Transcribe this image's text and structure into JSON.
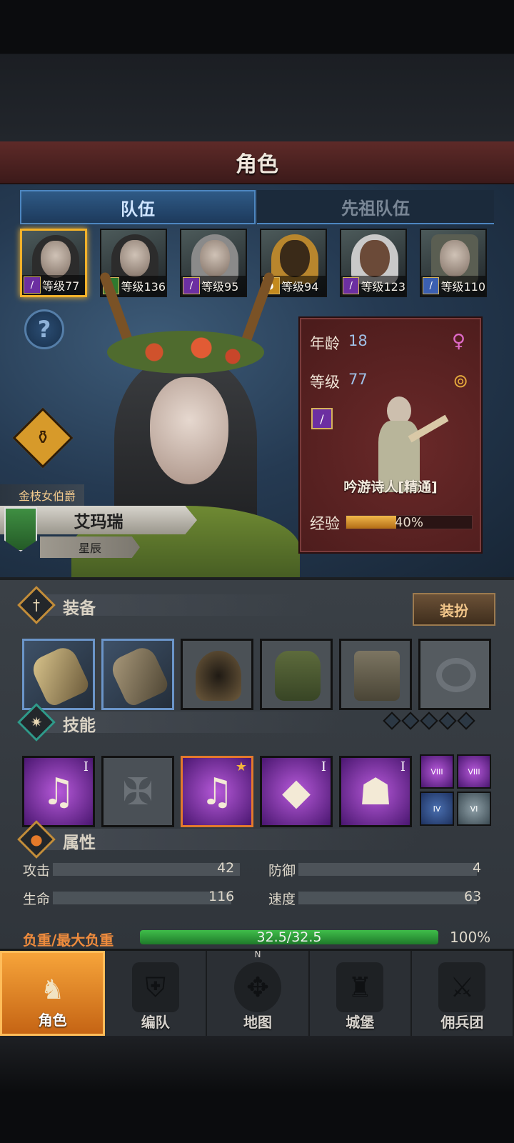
{
  "header": {
    "title": "角色"
  },
  "tabs": [
    {
      "label": "队伍",
      "active": true
    },
    {
      "label": "先祖队伍",
      "active": false
    }
  ],
  "party": [
    {
      "level_label": "等级77",
      "class_icon": "staff-icon",
      "selected": true
    },
    {
      "level_label": "等级136",
      "class_icon": "bow-icon",
      "selected": false
    },
    {
      "level_label": "等级95",
      "class_icon": "staff-icon",
      "selected": false
    },
    {
      "level_label": "等级94",
      "class_icon": "shield-icon",
      "selected": false
    },
    {
      "level_label": "等级123",
      "class_icon": "staff-icon",
      "selected": false
    },
    {
      "level_label": "等级110",
      "class_icon": "sword-icon",
      "selected": false
    }
  ],
  "hero": {
    "title": "金枝女伯爵",
    "name": "艾玛瑞",
    "rank": "星辰"
  },
  "info_card": {
    "age_label": "年龄",
    "age_value": "18",
    "level_label": "等级",
    "level_value": "77",
    "class_name": "吟游诗人[精通]",
    "exp_label": "经验",
    "exp_text": "40%",
    "exp_fraction": 0.4
  },
  "equipment": {
    "title": "装备",
    "dress_button": "装扮",
    "slots": [
      "weapon-icon",
      "weapon-icon",
      "hood-icon",
      "tunic-icon",
      "boots-icon",
      "ring-icon"
    ]
  },
  "skills": {
    "title": "技能",
    "items": [
      {
        "numeral": "I",
        "glyph": "♫"
      },
      {
        "numeral": "",
        "glyph": "✠"
      },
      {
        "numeral": "",
        "glyph": "♫"
      },
      {
        "numeral": "I",
        "glyph": "◆"
      },
      {
        "numeral": "I",
        "glyph": "☗"
      }
    ],
    "mini": [
      {
        "numeral": "VIII"
      },
      {
        "numeral": "VIII"
      },
      {
        "numeral": "IV"
      },
      {
        "numeral": "VI"
      }
    ]
  },
  "attributes": {
    "title": "属性",
    "attack_label": "攻击",
    "attack_value": "42",
    "defense_label": "防御",
    "defense_value": "4",
    "hp_label": "生命",
    "hp_value": "116",
    "speed_label": "速度",
    "speed_value": "63",
    "load_label": "负重/最大负重",
    "load_text": "32.5/32.5",
    "load_pct": "100%",
    "load_fraction": 1.0
  },
  "nav": [
    {
      "label": "角色",
      "icon": "knight-icon",
      "active": true
    },
    {
      "label": "编队",
      "icon": "helmet-icon",
      "active": false
    },
    {
      "label": "地图",
      "icon": "compass-icon",
      "active": false
    },
    {
      "label": "城堡",
      "icon": "castle-icon",
      "active": false
    },
    {
      "label": "佣兵团",
      "icon": "mercenary-icon",
      "active": false
    }
  ],
  "colors": {
    "accent": "#f1b12a",
    "skill_purple": "#b659d9",
    "load_green": "#3fbd4a",
    "title_red": "#5e2a28"
  }
}
